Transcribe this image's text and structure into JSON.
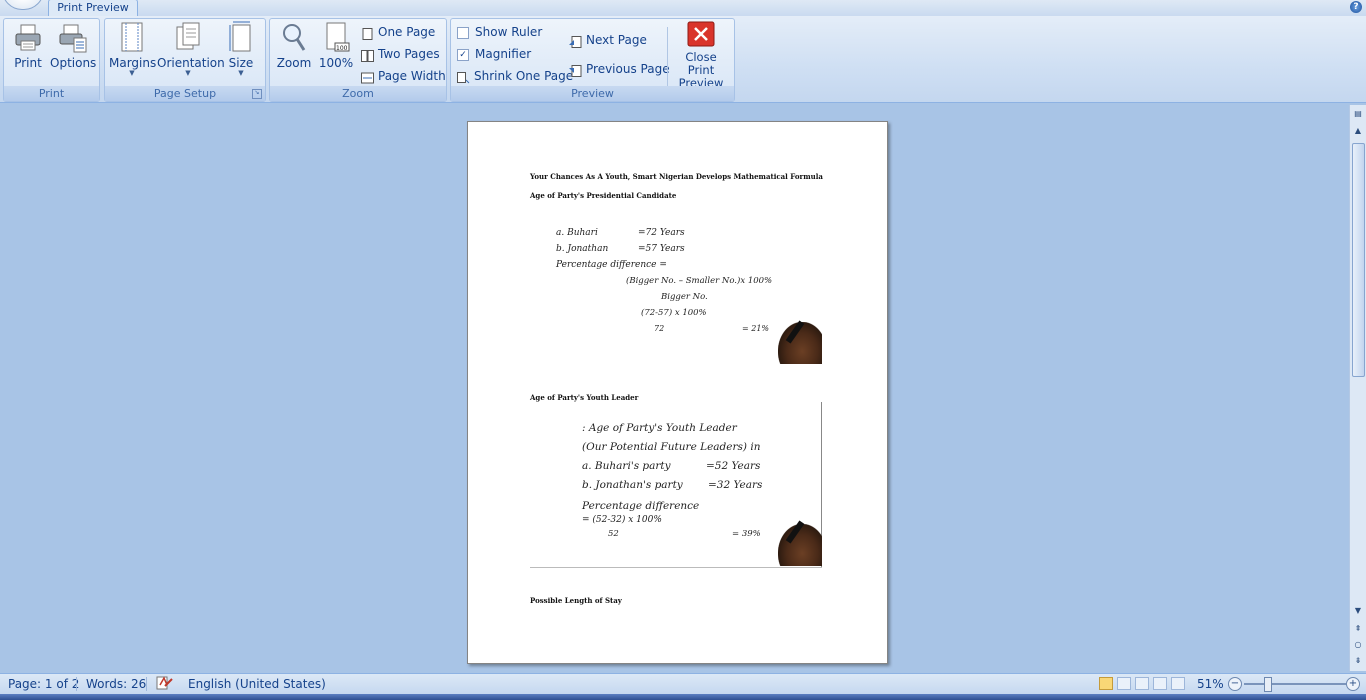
{
  "ribbon": {
    "tab": "Print Preview",
    "groups": {
      "print": {
        "label": "Print",
        "print": "Print",
        "options": "Options"
      },
      "page_setup": {
        "label": "Page Setup",
        "margins": "Margins",
        "orientation": "Orientation",
        "size": "Size"
      },
      "zoom": {
        "label": "Zoom",
        "zoom": "Zoom",
        "hundred": "100%",
        "one_page": "One Page",
        "two_pages": "Two Pages",
        "page_width": "Page Width"
      },
      "preview": {
        "label": "Preview",
        "show_ruler": "Show Ruler",
        "show_ruler_checked": false,
        "magnifier": "Magnifier",
        "magnifier_checked": true,
        "shrink_one_page": "Shrink One Page",
        "next_page": "Next Page",
        "previous_page": "Previous Page",
        "close_line1": "Close Print",
        "close_line2": "Preview"
      }
    }
  },
  "document": {
    "heading": "Your Chances As A Youth, Smart Nigerian Develops Mathematical Formula",
    "section1_title": "Age of Party's Presidential Candidate",
    "section1_lines": {
      "a": "a. Buhari",
      "a_val": "=72 Years",
      "b": "b. Jonathan",
      "b_val": "=57 Years",
      "pct": "Percentage difference =",
      "formula": "(Bigger No. – Smaller No.)x  100%",
      "denom": "Bigger No.",
      "calc": "(72-57)  x 100%",
      "calc_denom": "72",
      "result": "=  21%"
    },
    "section2_title": "Age of Party's Youth Leader",
    "section2_lines": {
      "l1": ": Age of Party's Youth Leader",
      "l2": "(Our Potential Future Leaders) in",
      "a": "a. Buhari's party",
      "a_val": "=52 Years",
      "b": "b. Jonathan's party",
      "b_val": "=32 Years",
      "pct": "Percentage difference",
      "calc": "=  (52-32)  x 100%",
      "calc_denom": "52",
      "result": "=  39%"
    },
    "section3_title": "Possible Length of Stay"
  },
  "status": {
    "page": "Page: 1 of 2",
    "words": "Words: 26",
    "language": "English (United States)",
    "zoom": "51%"
  },
  "colors": {
    "ribbon_text": "#15428b",
    "workspace": "#a8c4e6",
    "close_red": "#d9342b"
  }
}
